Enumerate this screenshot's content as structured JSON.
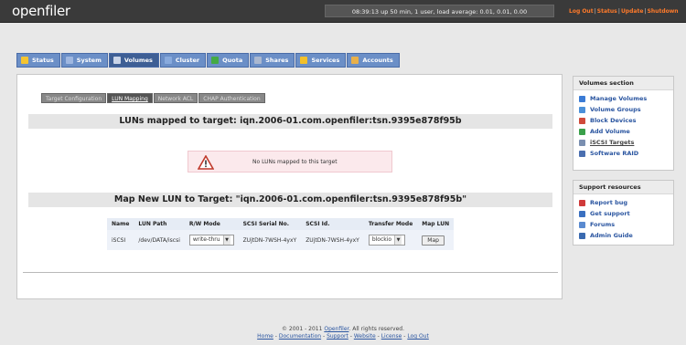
{
  "header": {
    "logo": "openfiler",
    "uptime": "08:39:13 up 50 min, 1 user, load average: 0.01, 0.01, 0.00",
    "links": [
      "Log Out",
      "Status",
      "Update",
      "Shutdown"
    ]
  },
  "tabs": [
    {
      "label": "Status",
      "icon": "status-icon",
      "color": "#f4c430"
    },
    {
      "label": "System",
      "icon": "system-icon",
      "color": "#9fb7e0"
    },
    {
      "label": "Volumes",
      "icon": "volumes-icon",
      "color": "#c9d4e8"
    },
    {
      "label": "Cluster",
      "icon": "cluster-icon",
      "color": "#88aadd"
    },
    {
      "label": "Quota",
      "icon": "quota-icon",
      "color": "#44aa44"
    },
    {
      "label": "Shares",
      "icon": "shares-icon",
      "color": "#aab8d0"
    },
    {
      "label": "Services",
      "icon": "services-icon",
      "color": "#f2c02a"
    },
    {
      "label": "Accounts",
      "icon": "accounts-icon",
      "color": "#e8b04a"
    }
  ],
  "subtabs": [
    "Target Configuration",
    "LUN Mapping",
    "Network ACL",
    "CHAP Authentication"
  ],
  "luns_mapped": {
    "title": "LUNs mapped to target: iqn.2006-01.com.openfiler:tsn.9395e878f95b",
    "empty_message": "No LUNs mapped to this target"
  },
  "map_new": {
    "title": "Map New LUN to Target: \"iqn.2006-01.com.openfiler:tsn.9395e878f95b\"",
    "columns": [
      "Name",
      "LUN Path",
      "R/W Mode",
      "SCSI Serial No.",
      "SCSI Id.",
      "Transfer Mode",
      "Map LUN"
    ],
    "row": {
      "name": "iSCSI",
      "path": "/dev/DATA/iscsi",
      "rw_mode": "write-thru",
      "serial": "ZUjtDN-7WSH-4yxY",
      "scsi_id": "ZUjtDN-7WSH-4yxY",
      "transfer_mode": "blockio",
      "map_label": "Map"
    }
  },
  "sidebar": {
    "volumes": {
      "title": "Volumes section",
      "items": [
        {
          "label": "Manage Volumes",
          "color": "#3a7bd5"
        },
        {
          "label": "Volume Groups",
          "color": "#4a90d9"
        },
        {
          "label": "Block Devices",
          "color": "#d04a3a"
        },
        {
          "label": "Add Volume",
          "color": "#3aa04a"
        },
        {
          "label": "iSCSI Targets",
          "color": "#7a8fb0"
        },
        {
          "label": "Software RAID",
          "color": "#4a6fb0"
        }
      ]
    },
    "support": {
      "title": "Support resources",
      "items": [
        {
          "label": "Report bug",
          "color": "#d03a3a"
        },
        {
          "label": "Get support",
          "color": "#3a70c0"
        },
        {
          "label": "Forums",
          "color": "#5a8ad0"
        },
        {
          "label": "Admin Guide",
          "color": "#3a6ab0"
        }
      ]
    }
  },
  "footer": {
    "copyright_prefix": "© 2001 - 2011 ",
    "brand": "Openfiler",
    "copyright_suffix": ". All rights reserved.",
    "links": [
      "Home",
      "Documentation",
      "Support",
      "Website",
      "License",
      "Log Out"
    ]
  }
}
